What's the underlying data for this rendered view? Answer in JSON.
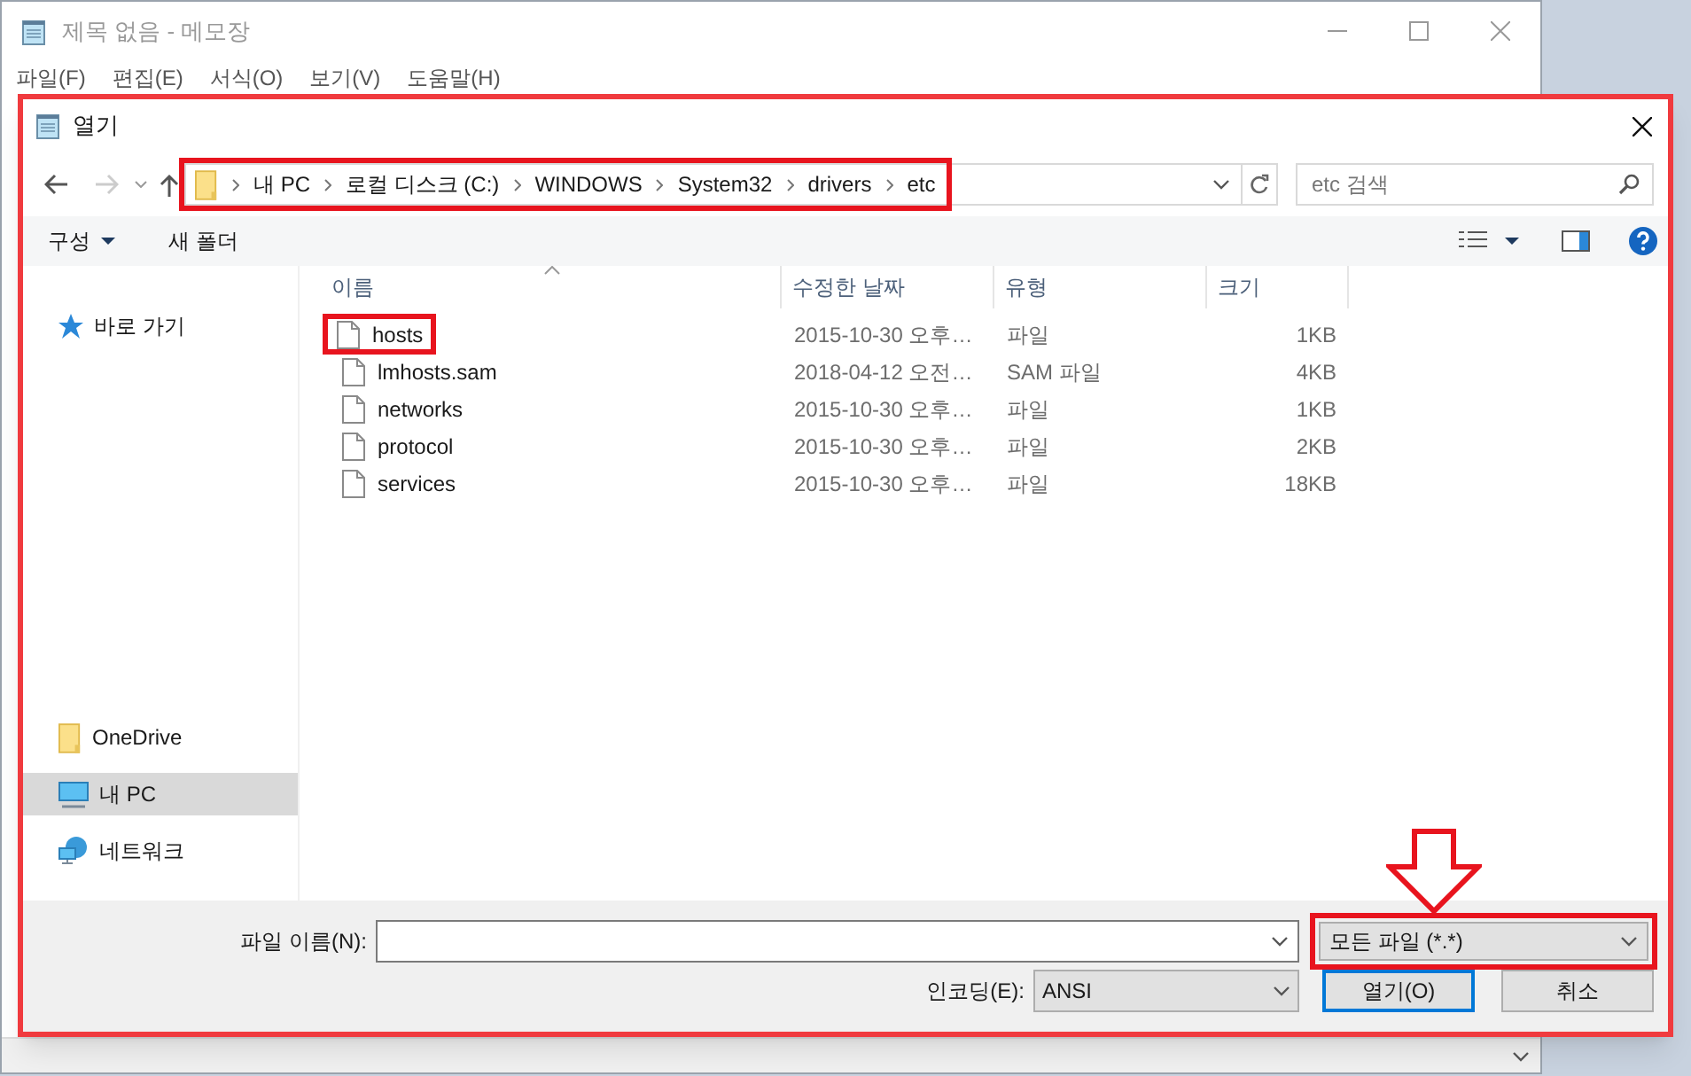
{
  "notepad": {
    "title": "제목 없음 - 메모장",
    "menu": [
      "파일(F)",
      "편집(E)",
      "서식(O)",
      "보기(V)",
      "도움말(H)"
    ]
  },
  "dialog": {
    "title": "열기",
    "path": {
      "segments": [
        "내 PC",
        "로컬 디스크 (C:)",
        "WINDOWS",
        "System32",
        "drivers",
        "etc"
      ],
      "highlighted": true
    },
    "search": {
      "placeholder": "etc 검색"
    },
    "toolbar": {
      "organize": "구성",
      "new_folder": "새 폴더"
    },
    "sidebar": [
      {
        "label": "바로 가기",
        "kind": "quick",
        "selected": false
      },
      {
        "label": "OneDrive",
        "kind": "folder",
        "selected": false
      },
      {
        "label": "내 PC",
        "kind": "pc",
        "selected": true
      },
      {
        "label": "네트워크",
        "kind": "network",
        "selected": false
      }
    ],
    "columns": [
      "이름",
      "수정한 날짜",
      "유형",
      "크기"
    ],
    "files": [
      {
        "name": "hosts",
        "modified": "2015-10-30 오후…",
        "type": "파일",
        "size": "1KB",
        "highlighted": true
      },
      {
        "name": "lmhosts.sam",
        "modified": "2018-04-12 오전…",
        "type": "SAM 파일",
        "size": "4KB",
        "highlighted": false
      },
      {
        "name": "networks",
        "modified": "2015-10-30 오후…",
        "type": "파일",
        "size": "1KB",
        "highlighted": false
      },
      {
        "name": "protocol",
        "modified": "2015-10-30 오후…",
        "type": "파일",
        "size": "2KB",
        "highlighted": false
      },
      {
        "name": "services",
        "modified": "2015-10-30 오후…",
        "type": "파일",
        "size": "18KB",
        "highlighted": false
      }
    ],
    "filename": {
      "label": "파일 이름(N):"
    },
    "filter": {
      "value": "모든 파일 (*.*)",
      "highlighted": true,
      "arrow": true
    },
    "encoding": {
      "label": "인코딩(E):",
      "value": "ANSI"
    },
    "buttons": [
      {
        "label": "열기(O)",
        "default": true
      },
      {
        "label": "취소",
        "default": false
      }
    ]
  }
}
